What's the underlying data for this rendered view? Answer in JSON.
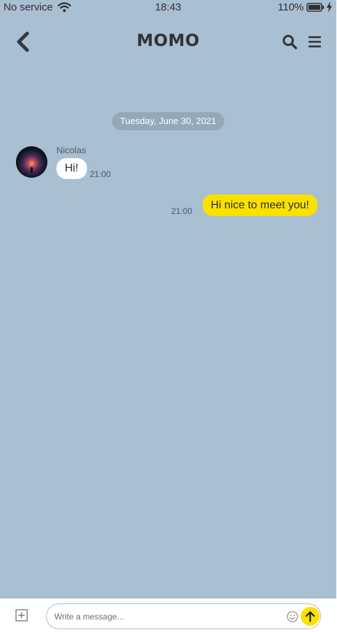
{
  "status_bar": {
    "carrier": "No service",
    "time": "18:43",
    "battery": "110%"
  },
  "header": {
    "title": "MOMO"
  },
  "conversation": {
    "date_separator": "Tuesday, June 30, 2021",
    "messages": [
      {
        "direction": "incoming",
        "sender": "Nicolas",
        "text": "Hi!",
        "time": "21:00"
      },
      {
        "direction": "outgoing",
        "text": "Hi nice to meet you!",
        "time": "21:00"
      }
    ]
  },
  "composer": {
    "value": "",
    "placeholder": "Write a message..."
  },
  "colors": {
    "chat_background": "#a9bfd2",
    "outgoing_bubble": "#fae100",
    "incoming_bubble": "#ffffff",
    "date_pill": "#95a8b8",
    "send_button": "#fae100"
  },
  "icons": [
    "wifi-icon",
    "battery-icon",
    "charging-bolt-icon",
    "back-chevron-icon",
    "search-icon",
    "hamburger-menu-icon",
    "add-attachment-icon",
    "emoji-icon",
    "arrow-up-icon"
  ]
}
